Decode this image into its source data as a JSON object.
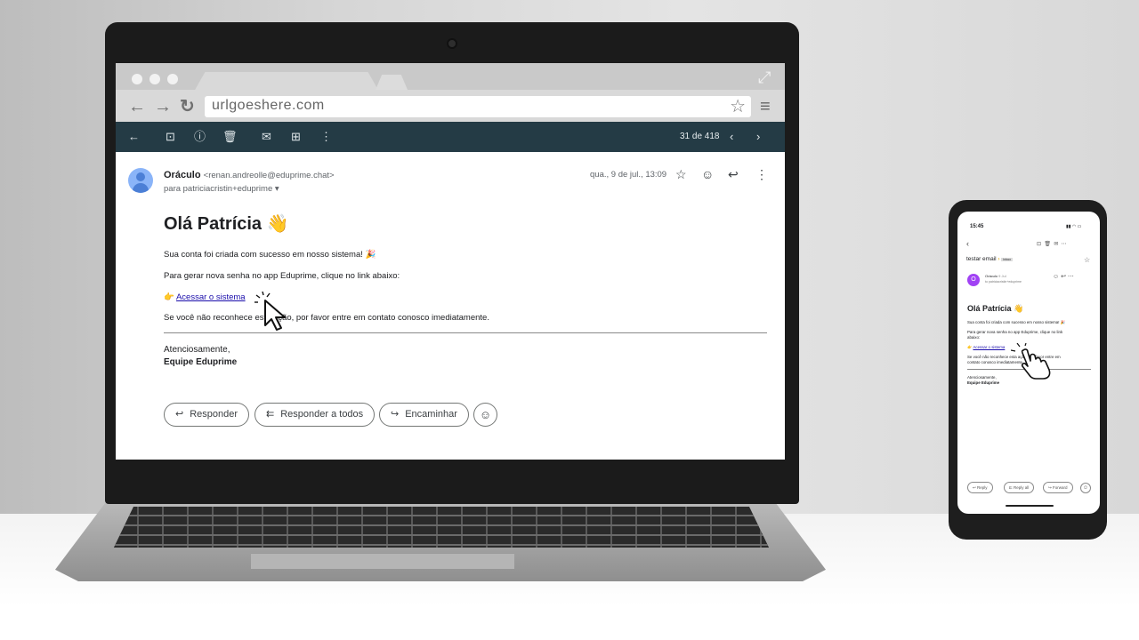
{
  "browser": {
    "url": "urlgoeshere.com"
  },
  "toolbar": {
    "counter": "31 de 418"
  },
  "email": {
    "sender_name": "Oráculo",
    "sender_address": "<renan.andreolle@eduprime.chat>",
    "recipient_line": "para patriciacristin+eduprime",
    "date": "qua., 9 de jul., 13:09",
    "greeting": "Olá Patrícia 👋",
    "line1": "Sua conta foi criada com sucesso em nosso sistema! 🎉",
    "line2": "Para gerar nova senha no app Eduprime, clique no link abaixo:",
    "link_prefix": "👉",
    "link_text": "Acessar o sistema",
    "line3": "Se você não reconhece esta ação, por favor entre em contato conosco imediatamente.",
    "closing": "Atenciosamente,",
    "team": "Equipe Eduprime"
  },
  "actions": {
    "reply": "Responder",
    "reply_all": "Responder a todos",
    "forward": "Encaminhar"
  },
  "phone": {
    "time": "15:45",
    "subject": "testar email",
    "label": "Inbox",
    "sender_initial": "O",
    "sender_name": "Oráculo",
    "sender_meta": "9 Jul",
    "sender_to": "to patriciacristin+eduprime",
    "greeting": "Olá Patrícia 👋",
    "line1": "Sua conta foi criada com sucesso em nosso sistema! 🎉",
    "line2a": "Para gerar nova senha no app Eduprime, clique no link",
    "line2b": "abaixo:",
    "link_text": "Acessar o sistema",
    "line3a": "Se você não reconhece esta ação, por favor entre em",
    "line3b": "contato conosco imediatamente.",
    "closing": "Atenciosamente,",
    "team": "Equipe Eduprime",
    "reply": "Reply",
    "reply_all": "Reply all",
    "forward": "Forward"
  },
  "colors": {
    "toolbar_bg": "#243b45",
    "link": "#1a0dab",
    "avatar": "#8ab4f8",
    "phone_avatar": "#a142f4"
  }
}
